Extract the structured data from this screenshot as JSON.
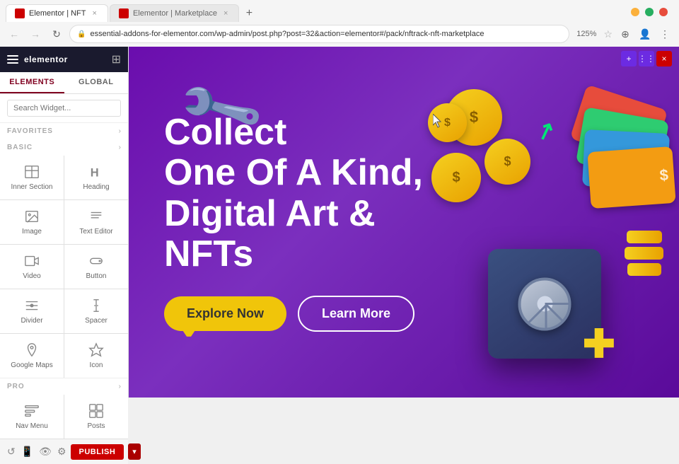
{
  "browser": {
    "tabs": [
      {
        "id": "tab1",
        "label": "Elementor | NFT",
        "active": true,
        "favicon_color": "#c00"
      },
      {
        "id": "tab2",
        "label": "Elementor | Marketplace",
        "active": false,
        "favicon_color": "#c00"
      }
    ],
    "address": "essential-addons-for-elementor.com/wp-admin/post.php?post=32&action=elementor#/pack/nftrack-nft-marketplace",
    "zoom": "125%",
    "new_tab_label": "+"
  },
  "sidebar": {
    "logo": "elementor",
    "tabs": [
      "ELEMENTS",
      "GLOBAL"
    ],
    "active_tab": "ELEMENTS",
    "search_placeholder": "Search Widget...",
    "sections": {
      "favorites": {
        "label": "FAVORITES",
        "expanded": true
      },
      "basic": {
        "label": "BASIC",
        "expanded": true
      },
      "pro": {
        "label": "PRO",
        "expanded": true
      }
    },
    "basic_widgets": [
      {
        "id": "inner-section",
        "label": "Inner Section",
        "icon": "inner-section-icon"
      },
      {
        "id": "heading",
        "label": "Heading",
        "icon": "heading-icon"
      },
      {
        "id": "image",
        "label": "Image",
        "icon": "image-icon"
      },
      {
        "id": "text-editor",
        "label": "Text Editor",
        "icon": "text-editor-icon"
      },
      {
        "id": "video",
        "label": "Video",
        "icon": "video-icon"
      },
      {
        "id": "button",
        "label": "Button",
        "icon": "button-icon"
      },
      {
        "id": "divider",
        "label": "Divider",
        "icon": "divider-icon"
      },
      {
        "id": "spacer",
        "label": "Spacer",
        "icon": "spacer-icon"
      },
      {
        "id": "google-maps",
        "label": "Google Maps",
        "icon": "map-icon"
      },
      {
        "id": "icon",
        "label": "Icon",
        "icon": "icon-icon"
      }
    ],
    "pro_widgets": [
      {
        "id": "nav-menu",
        "label": "Nav Menu",
        "icon": "nav-menu-icon"
      },
      {
        "id": "posts",
        "label": "Posts",
        "icon": "posts-icon"
      }
    ],
    "footer": {
      "publish_label": "PUBLISH",
      "icons": [
        "history-icon",
        "responsive-icon",
        "preview-icon",
        "settings-icon"
      ]
    }
  },
  "canvas": {
    "toolbar": {
      "add_btn": "+",
      "move_btn": "⋮⋮",
      "close_btn": "×"
    }
  },
  "hero": {
    "title_line1": "Collect",
    "title_line2": "One Of A Kind,",
    "title_line3": "Digital Art &",
    "title_line4": "NFTs",
    "btn_explore": "Explore Now",
    "btn_learn": "Learn More"
  }
}
